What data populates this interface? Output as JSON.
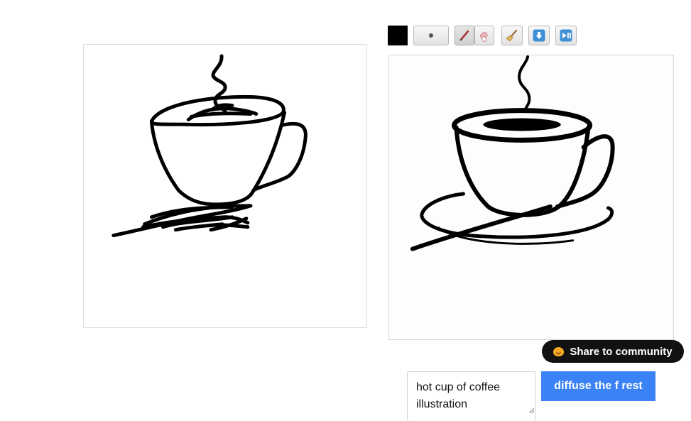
{
  "toolbar": {
    "brush_color": "#000000",
    "tools": [
      "color-swatch",
      "brush-size",
      "pen-icon",
      "eraser-icon",
      "broom-icon",
      "download-icon",
      "play-pause-icon"
    ]
  },
  "share": {
    "label": "Share to community",
    "icon": "hugging-face-icon"
  },
  "prompt": {
    "value": "hot cup of coffee illustration"
  },
  "action": {
    "label": "diffuse the f rest",
    "color": "#3b82f6"
  }
}
